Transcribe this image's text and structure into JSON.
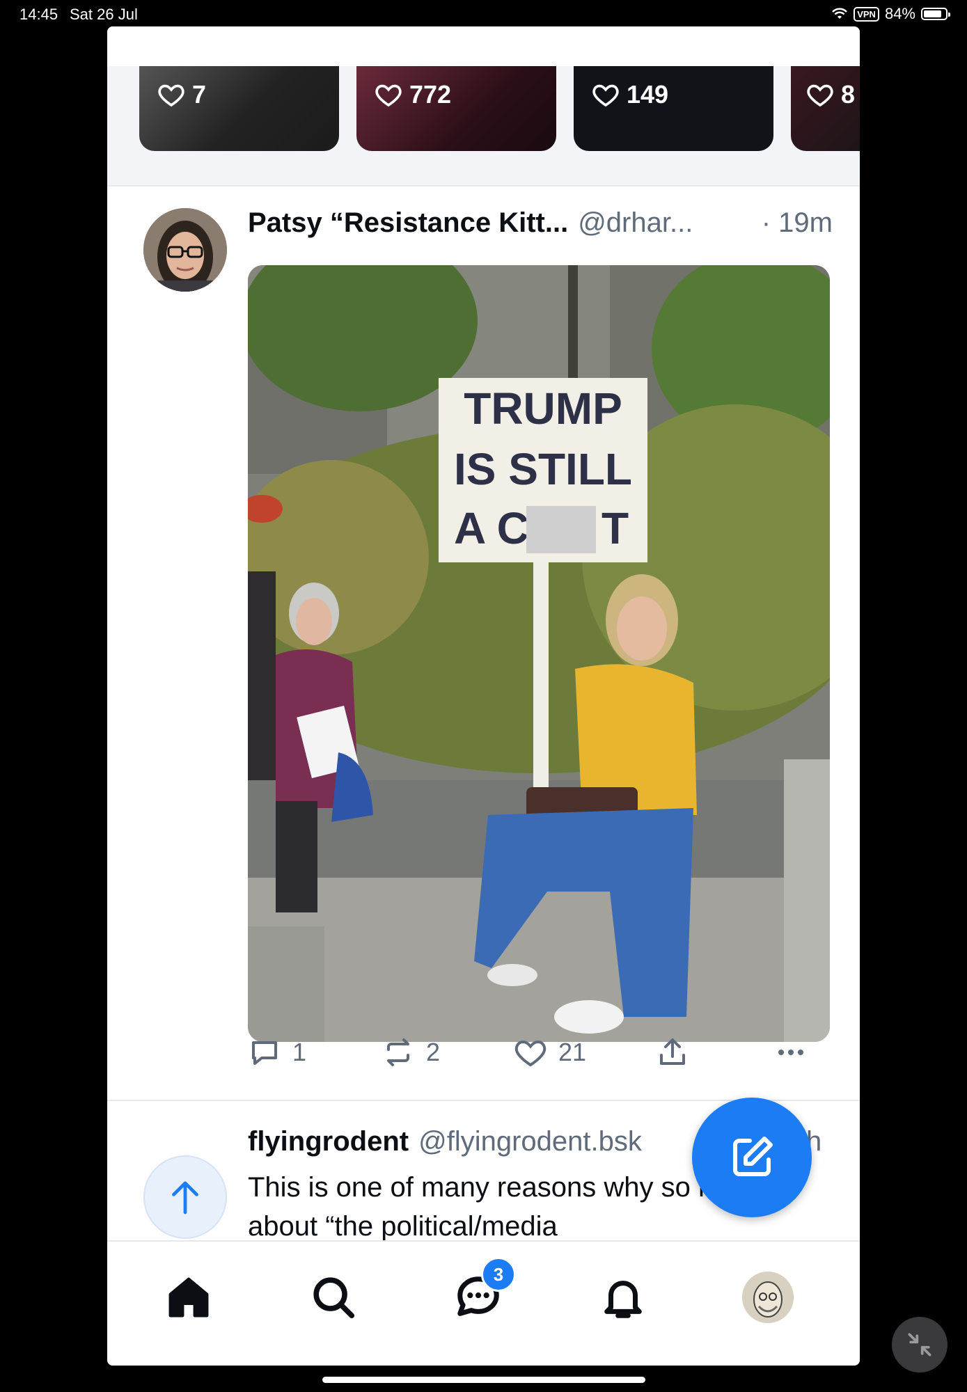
{
  "status_bar": {
    "time": "14:45",
    "date": "Sat 26 Jul",
    "vpn": "VPN",
    "battery": "84%",
    "battery_level": 0.84
  },
  "trending": [
    {
      "likes": "7"
    },
    {
      "likes": "772"
    },
    {
      "likes": "149"
    },
    {
      "likes": "8"
    }
  ],
  "post": {
    "author_name": "Patsy “Resistance Kitt...",
    "author_handle": "@drhar...",
    "time": "· 19m",
    "image_sign_text": [
      "TRUMP",
      "IS STILL",
      "A C",
      "T"
    ],
    "replies": "1",
    "reposts": "2",
    "likes": "21"
  },
  "next_post": {
    "author_name": "flyingrodent",
    "author_handle": "@flyingrodent.bsk",
    "time": "h",
    "text": "This is one of many reasons why so much about “the political/media"
  },
  "tabs": {
    "messages_badge": "3"
  },
  "colors": {
    "accent": "#1c7cf4",
    "text_primary": "#0b0f14",
    "text_secondary": "#5f6b7a",
    "feed_strip_bg": "#f2f4f7"
  }
}
